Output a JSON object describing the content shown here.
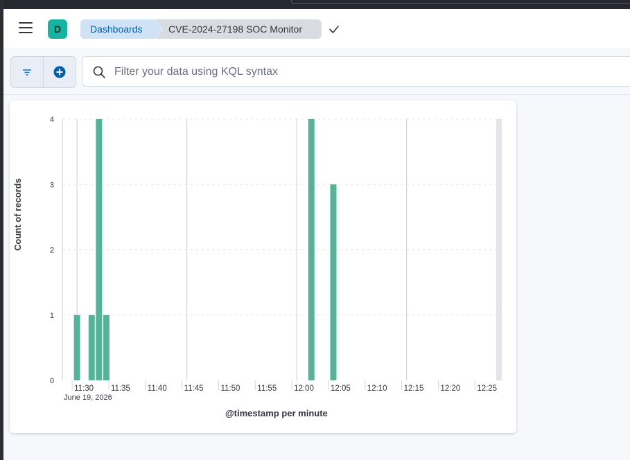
{
  "header": {
    "space_initial": "D",
    "breadcrumbs": [
      "Dashboards",
      "CVE-2024-27198 SOC Monitor"
    ]
  },
  "filter_bar": {
    "search_placeholder": "Filter your data using KQL syntax"
  },
  "colors": {
    "bar": "#54b399",
    "accent": "#0077cc",
    "avatar": "#16b3a0"
  },
  "chart_data": {
    "type": "bar",
    "xlabel": "@timestamp per minute",
    "ylabel": "Count of records",
    "date_label": "June 19, 2026",
    "ylim": [
      0,
      4
    ],
    "y_ticks": [
      0,
      1,
      2,
      3,
      4
    ],
    "x_ticks": [
      "11:30",
      "11:35",
      "11:40",
      "11:45",
      "11:50",
      "11:55",
      "12:00",
      "12:05",
      "12:10",
      "12:15",
      "12:20",
      "12:25"
    ],
    "x_range": [
      "11:28",
      "12:28"
    ],
    "grid": true,
    "bars": [
      {
        "time": "11:30",
        "value": 1
      },
      {
        "time": "11:32",
        "value": 1
      },
      {
        "time": "11:33",
        "value": 4
      },
      {
        "time": "11:34",
        "value": 1
      },
      {
        "time": "12:02",
        "value": 4
      },
      {
        "time": "12:05",
        "value": 3
      }
    ]
  }
}
